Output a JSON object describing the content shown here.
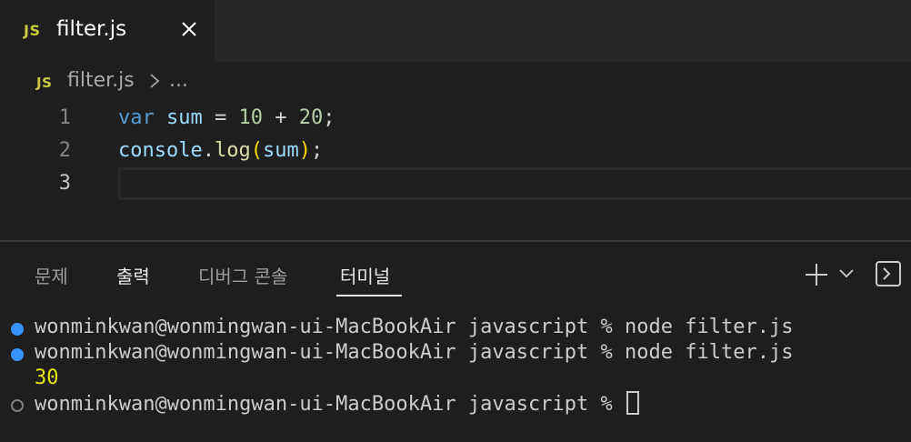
{
  "tab": {
    "badge": "JS",
    "title": "filter.js"
  },
  "breadcrumb": {
    "badge": "JS",
    "file": "filter.js",
    "ellipsis": "..."
  },
  "editor": {
    "line_numbers": [
      "1",
      "2",
      "3"
    ],
    "line1": {
      "kw": "var",
      "var": "sum",
      "eq": " = ",
      "n1": "10",
      "plus": " + ",
      "n2": "20",
      "semi": ";"
    },
    "line2": {
      "obj": "console",
      "dot": ".",
      "fn": "log",
      "open": "(",
      "arg": "sum",
      "close": ")",
      "semi": ";"
    }
  },
  "panel": {
    "tabs": [
      "문제",
      "출력",
      "디버그 콘솔",
      "터미널"
    ],
    "active_tab": "터미널"
  },
  "terminal": {
    "lines": [
      "wonminkwan@wonmingwan-ui-MacBookAir javascript % node filter.js",
      "wonminkwan@wonmingwan-ui-MacBookAir javascript % node filter.js",
      "30",
      "wonminkwan@wonmingwan-ui-MacBookAir javascript % "
    ]
  },
  "colors": {
    "badge": "#cbcb41",
    "keyword": "#569cd6",
    "variable": "#9cdcfe",
    "number": "#b5cea8",
    "function": "#dcdcaa",
    "output": "#e5e510",
    "dot_blue": "#3794ff"
  }
}
